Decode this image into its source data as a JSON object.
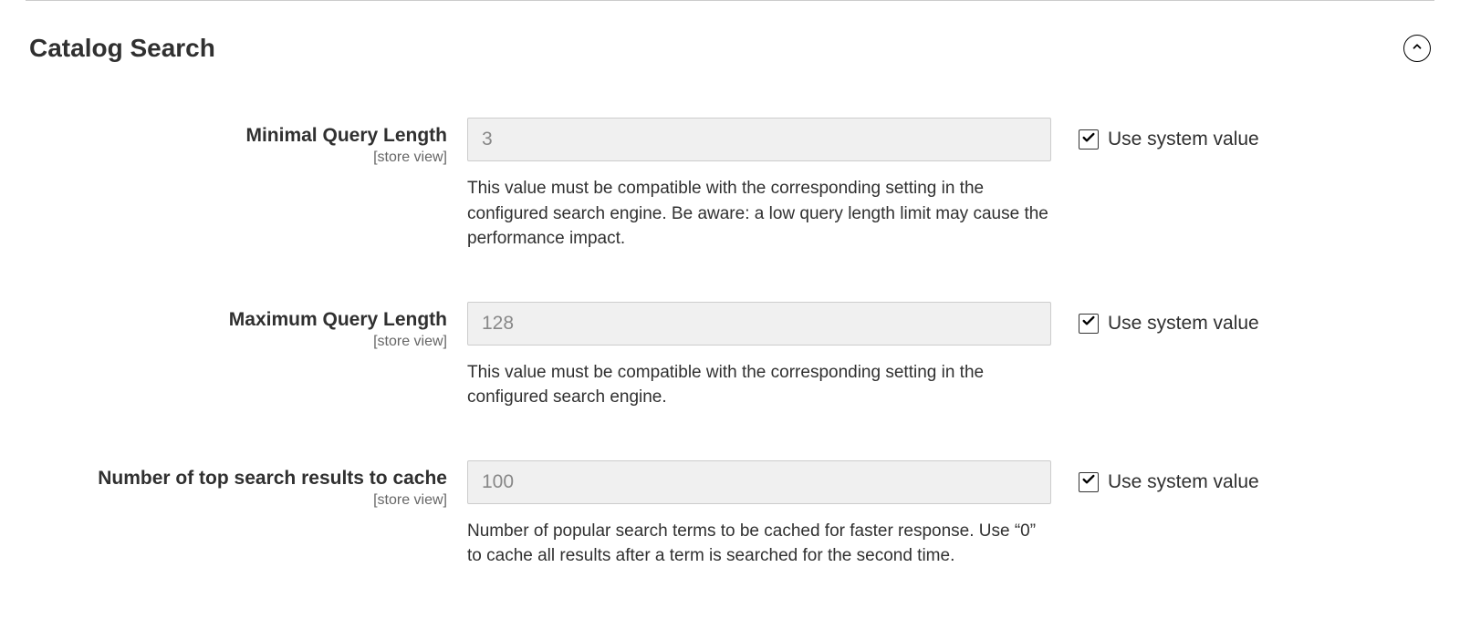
{
  "section": {
    "title": "Catalog Search"
  },
  "fields": [
    {
      "label": "Minimal Query Length",
      "scope": "[store view]",
      "value": "3",
      "help": "This value must be compatible with the corresponding setting in the configured search engine. Be aware: a low query length limit may cause the performance impact.",
      "use_system": "Use system value"
    },
    {
      "label": "Maximum Query Length",
      "scope": "[store view]",
      "value": "128",
      "help": "This value must be compatible with the corresponding setting in the configured search engine.",
      "use_system": "Use system value"
    },
    {
      "label": "Number of top search results to cache",
      "scope": "[store view]",
      "value": "100",
      "help": "Number of popular search terms to be cached for faster response. Use “0” to cache all results after a term is searched for the second time.",
      "use_system": "Use system value"
    }
  ]
}
